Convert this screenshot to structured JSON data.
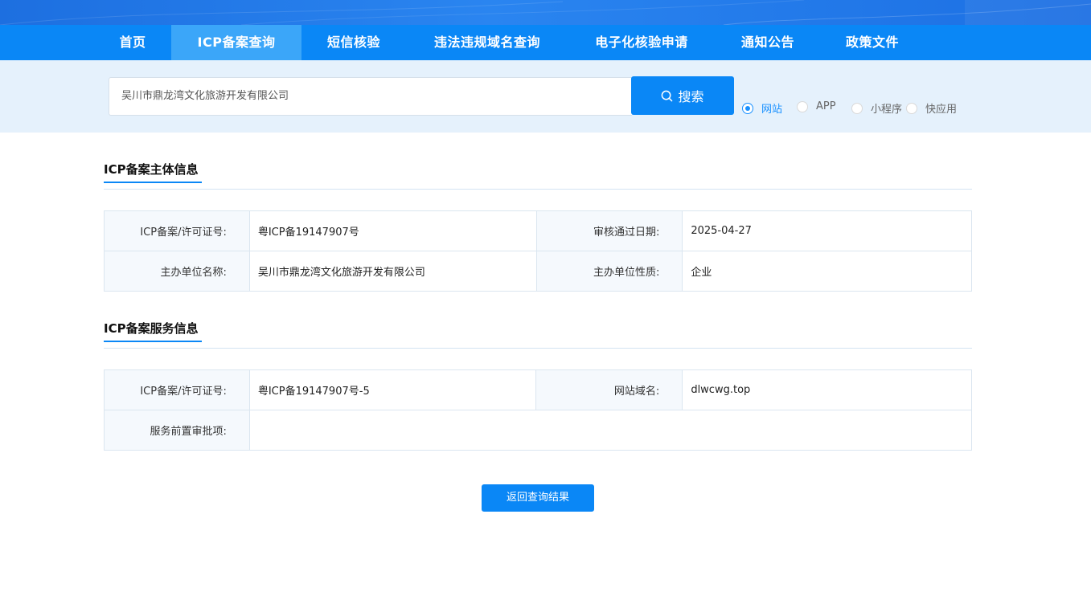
{
  "nav": {
    "items": [
      {
        "label": "首页",
        "active": false
      },
      {
        "label": "ICP备案查询",
        "active": true
      },
      {
        "label": "短信核验",
        "active": false
      },
      {
        "label": "违法违规域名查询",
        "active": false
      },
      {
        "label": "电子化核验申请",
        "active": false
      },
      {
        "label": "通知公告",
        "active": false
      },
      {
        "label": "政策文件",
        "active": false
      }
    ]
  },
  "search": {
    "value": "吴川市鼎龙湾文化旅游开发有限公司",
    "button_label": "搜索",
    "button_icon": "search-icon",
    "options": [
      {
        "label": "网站",
        "checked": true
      },
      {
        "label": "APP",
        "checked": false
      },
      {
        "label": "小程序",
        "checked": false
      },
      {
        "label": "快应用",
        "checked": false
      }
    ]
  },
  "subject_section": {
    "title": "ICP备案主体信息",
    "rows": [
      {
        "label1": "ICP备案/许可证号:",
        "value1": "粤ICP备19147907号",
        "label2": "审核通过日期:",
        "value2": "2025-04-27"
      },
      {
        "label1": "主办单位名称:",
        "value1": "吴川市鼎龙湾文化旅游开发有限公司",
        "label2": "主办单位性质:",
        "value2": "企业"
      }
    ]
  },
  "service_section": {
    "title": "ICP备案服务信息",
    "license_label": "ICP备案/许可证号:",
    "license_value": "粤ICP备19147907号-5",
    "domain_label": "网站域名:",
    "domain_value": "dlwcwg.top",
    "approval_label": "服务前置审批项:",
    "approval_value": ""
  },
  "back_button_label": "返回查询结果",
  "colors": {
    "primary": "#0a87f6",
    "nav_active": "#3ba6f9",
    "search_band": "#e5f1fc"
  }
}
